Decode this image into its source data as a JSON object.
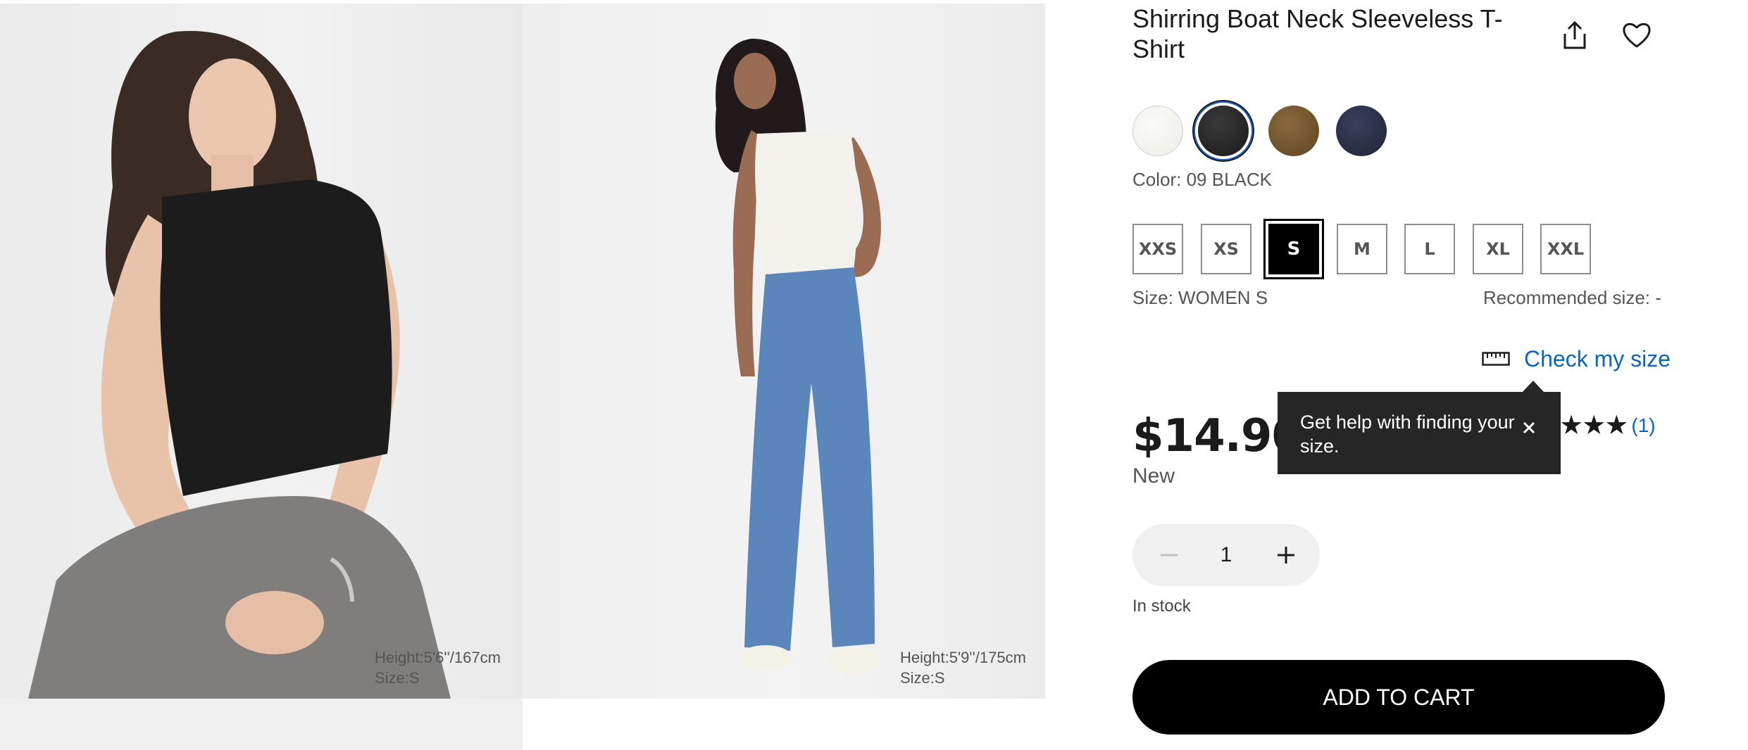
{
  "product": {
    "title": "Shirring Boat Neck Sleeveless T-Shirt",
    "share_icon": "share-icon",
    "wishlist_icon": "heart-icon"
  },
  "images": [
    {
      "caption_height": "Height:5'6''/167cm",
      "caption_size": "Size:S",
      "top_color": "#1a1a1a",
      "bottom_color": "#7f7e7c"
    },
    {
      "caption_height": "Height:5'9''/175cm",
      "caption_size": "Size:S",
      "top_color": "#f2f1ec",
      "bottom_color": "#5a86bb"
    }
  ],
  "colors": {
    "swatches": [
      {
        "name": "white",
        "hex": "#f5f5f2"
      },
      {
        "name": "black",
        "hex": "#222222",
        "selected": true
      },
      {
        "name": "olive",
        "hex": "#6f5430"
      },
      {
        "name": "navy",
        "hex": "#2b304a"
      }
    ],
    "selected_label": "Color: 09 BLACK"
  },
  "sizes": {
    "options": [
      "XXS",
      "XS",
      "S",
      "M",
      "L",
      "XL",
      "XXL"
    ],
    "selected": "S",
    "selected_label": "Size: WOMEN S",
    "recommended_label": "Recommended size: -"
  },
  "size_help": {
    "link_label": "Check my size",
    "icon": "ruler-icon",
    "tooltip_text": "Get help with finding your size."
  },
  "pricing": {
    "price": "$14.90",
    "flag": "New"
  },
  "reviews": {
    "rating": 5,
    "count_label": "(1)"
  },
  "quantity": {
    "value": "1"
  },
  "stock_status": "In stock",
  "cart": {
    "add_label": "ADD TO CART"
  },
  "theme": {
    "link_blue": "#0a63c7",
    "tooltip_bg": "#262626"
  }
}
